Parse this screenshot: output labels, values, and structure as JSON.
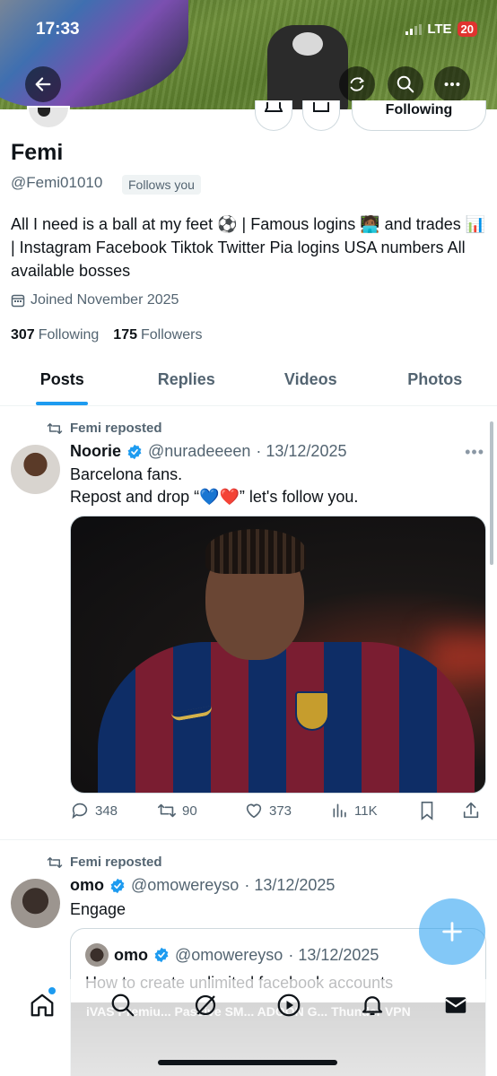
{
  "status_bar": {
    "time": "17:33",
    "network": "LTE",
    "battery": "20"
  },
  "profile": {
    "name": "Femi",
    "handle": "@Femi01010",
    "follows_you": "Follows you",
    "bio": "All I need is a ball at my feet ⚽ | Famous logins 🧑🏾‍💻 and trades 📊 | Instagram Facebook Tiktok Twitter Pia logins USA numbers All available bosses",
    "joined": "Joined November 2025",
    "following_count": "307",
    "following_label": "Following",
    "followers_count": "175",
    "followers_label": "Followers",
    "following_button": "Following"
  },
  "tabs": [
    "Posts",
    "Replies",
    "Videos",
    "Photos"
  ],
  "posts": [
    {
      "repost_label": "Femi reposted",
      "author": "Noorie",
      "handle": "@nuradeeeen",
      "date": "· 13/12/2025",
      "text_line1": "Barcelona fans.",
      "text_line2": "Repost and drop “💙❤️” let's follow you.",
      "replies": "348",
      "reposts": "90",
      "likes": "373",
      "views": "11K"
    },
    {
      "repost_label": "Femi reposted",
      "author": "omo",
      "handle": "@omowereyso",
      "date": "· 13/12/2025",
      "text_line1": "Engage",
      "quote": {
        "author": "omo",
        "handle": "@omowereyso",
        "date": "· 13/12/2025",
        "text": "How to create unlimited facebook accounts"
      }
    }
  ],
  "ticker_text": "iVAS Premiu...   Passive SM...   ADOON G...   Thunder VPN",
  "colors": {
    "accent": "#1d9bf0",
    "text": "#0f1419",
    "muted": "#536471"
  }
}
